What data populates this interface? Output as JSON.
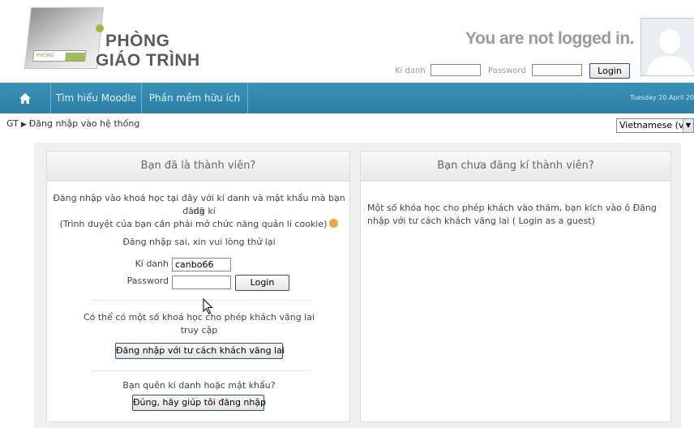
{
  "logo": {
    "line1": "PHÒNG",
    "line2": "GIÁO TRÌNH",
    "strip_text": "PHÒNG"
  },
  "header": {
    "status": "You are not logged in.",
    "username_label": "Kí danh",
    "password_label": "Password",
    "login_button": "Login",
    "avatar_icon": "user-avatar-icon"
  },
  "nav": {
    "home_icon": "home-icon",
    "items": [
      "Tìm hiểu Moodle",
      "Phần mềm hữu ích"
    ],
    "date": "Tuesday 20 April 20"
  },
  "breadcrumb": {
    "root": "GT",
    "separator": "▶",
    "current": "Đăng nhập vào hệ thống"
  },
  "language": {
    "selected": "Vietnamese (vi)"
  },
  "left_box": {
    "title": "Bạn đã là thành viên?",
    "intro_line1": "Đăng nhập vào khoá học tại đây với kí danh và mật khẩu mà bạn đã",
    "intro_line2": "đăng kí",
    "cookie_note": "(Trình duyệt của bạn cần phải mở chức năng quản lí cookie)",
    "error": "Đăng nhập sai, xin vui lòng thử lại",
    "username_label": "Kí danh",
    "username_value": "canbo66",
    "password_label": "Password",
    "login_button": "Login",
    "guest_line1": "Có thể có một số khoá học cho phép khách vãng lai",
    "guest_line2": "truy cập",
    "guest_button": "Đăng nhập với tư cách khách vãng lai",
    "forgot": "Bạn quên kí danh hoặc mật khẩu?",
    "forgot_button": "Đúng, hãy giúp tôi đăng nhập"
  },
  "right_box": {
    "title": "Bạn chưa đăng kí thành viên?",
    "line1": "Một số khóa học cho phép khách vào thăm, bạn kích vào ô Đăng",
    "line2": "nhập với tư cách khách vãng lai ( Login as a guest)"
  },
  "colors": {
    "nav_bar": "#2d7fa4",
    "button_border": "#2d4f7a",
    "help_icon": "#f0a24a"
  }
}
